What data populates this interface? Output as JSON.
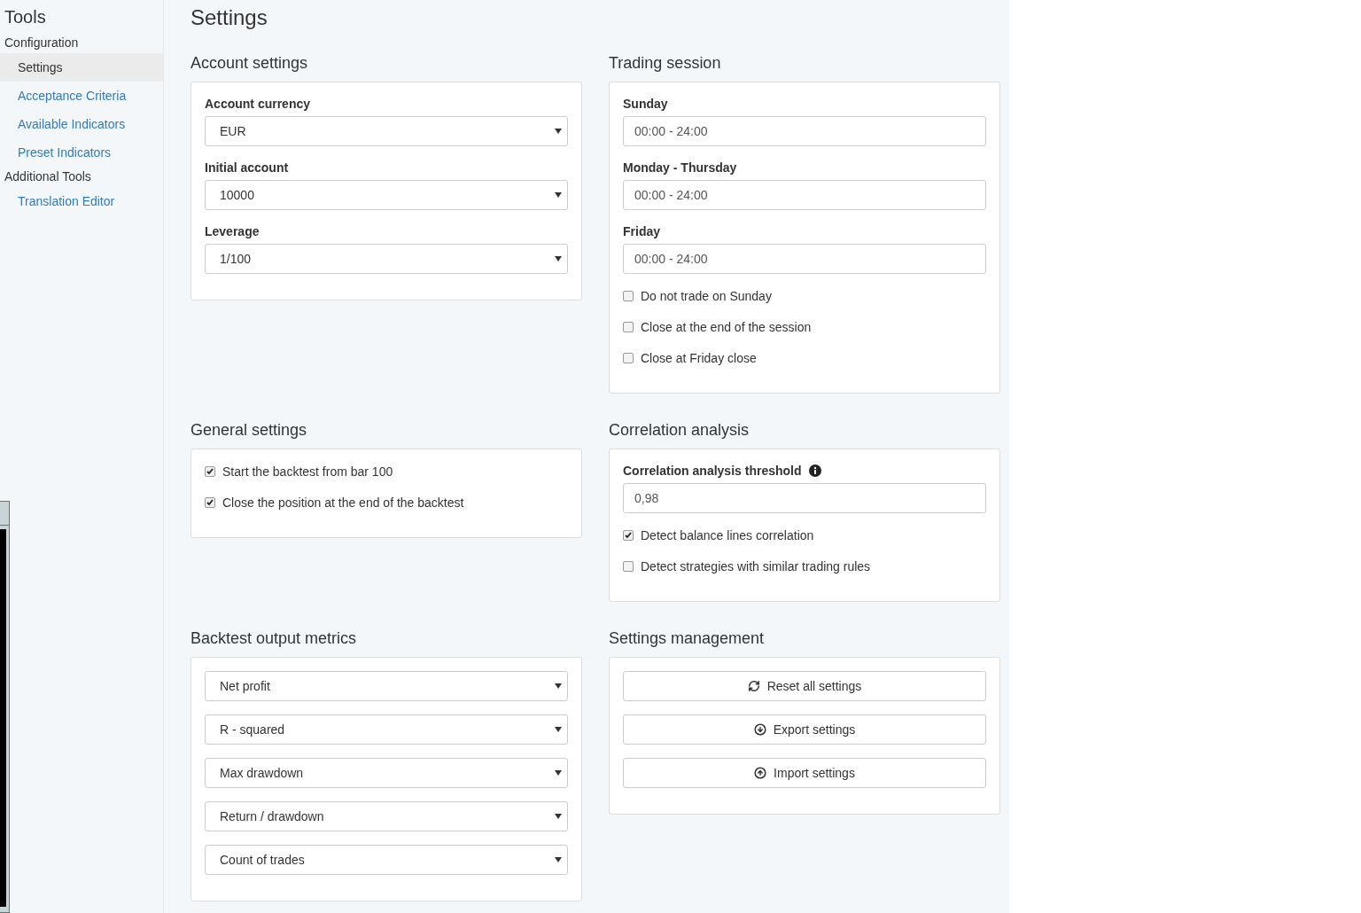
{
  "sidebar": {
    "title": "Tools",
    "groups": [
      {
        "label": "Configuration",
        "items": [
          {
            "label": "Settings",
            "selected": true
          },
          {
            "label": "Acceptance Criteria",
            "selected": false
          },
          {
            "label": "Available Indicators",
            "selected": false
          },
          {
            "label": "Preset Indicators",
            "selected": false
          }
        ]
      },
      {
        "label": "Additional Tools",
        "items": [
          {
            "label": "Translation Editor",
            "selected": false
          }
        ]
      }
    ]
  },
  "page_title": "Settings",
  "sections": [
    {
      "title": "Account settings",
      "items": [
        {
          "kind": "select",
          "label": "Account currency",
          "value": "EUR"
        },
        {
          "kind": "select",
          "label": "Initial account",
          "value": "10000"
        },
        {
          "kind": "select",
          "label": "Leverage",
          "value": "1/100"
        }
      ]
    },
    {
      "title": "Trading session",
      "items": [
        {
          "kind": "input",
          "label": "Sunday",
          "value": "00:00 - 24:00"
        },
        {
          "kind": "input",
          "label": "Monday - Thursday",
          "value": "00:00 - 24:00"
        },
        {
          "kind": "input",
          "label": "Friday",
          "value": "00:00 - 24:00"
        },
        {
          "kind": "checkbox",
          "label": "Do not trade on Sunday",
          "checked": false
        },
        {
          "kind": "checkbox",
          "label": "Close at the end of the session",
          "checked": false
        },
        {
          "kind": "checkbox",
          "label": "Close at Friday close",
          "checked": false
        }
      ]
    },
    {
      "title": "General settings",
      "items": [
        {
          "kind": "checkbox",
          "label": "Start the backtest from bar 100",
          "checked": true
        },
        {
          "kind": "checkbox",
          "label": "Close the position at the end of the backtest",
          "checked": true
        }
      ]
    },
    {
      "title": "Correlation analysis",
      "items": [
        {
          "kind": "info_input",
          "label": "Correlation analysis threshold",
          "value": "0,98"
        },
        {
          "kind": "checkbox",
          "label": "Detect balance lines correlation",
          "checked": true
        },
        {
          "kind": "checkbox",
          "label": "Detect strategies with similar trading rules",
          "checked": false
        }
      ]
    },
    {
      "title": "Backtest output metrics",
      "items": [
        {
          "kind": "select",
          "value": "Net profit"
        },
        {
          "kind": "select",
          "value": "R - squared"
        },
        {
          "kind": "select",
          "value": "Max drawdown"
        },
        {
          "kind": "select",
          "value": "Return / drawdown"
        },
        {
          "kind": "select",
          "value": "Count of trades"
        }
      ]
    },
    {
      "title": "Settings management",
      "items": [
        {
          "kind": "button",
          "label": "Reset all settings"
        },
        {
          "kind": "button",
          "label": "Export settings"
        },
        {
          "kind": "button",
          "label": "Import settings"
        }
      ]
    }
  ]
}
